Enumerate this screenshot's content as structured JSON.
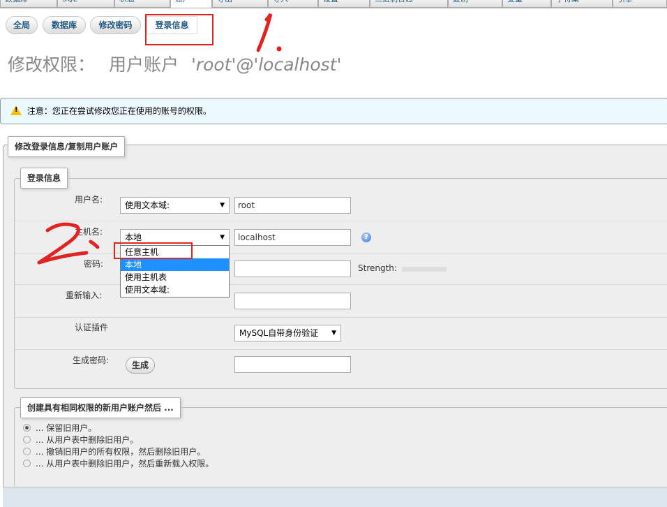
{
  "top_tabs": [
    "数据库",
    "SQL",
    "状态",
    "账户",
    "导出",
    "导入",
    "设置",
    "二进制日志",
    "复制",
    "变量",
    "字符集",
    "引擎"
  ],
  "sub_tabs": [
    {
      "label": "全局"
    },
    {
      "label": "数据库"
    },
    {
      "label": "修改密码"
    },
    {
      "label": "登录信息"
    }
  ],
  "title": {
    "prefix": "修改权限：",
    "account_label": "用户账户",
    "account": "'root'@'localhost'"
  },
  "notice": {
    "text": "注意：您正在尝试修改您正在使用的账号的权限。"
  },
  "outer_legend": "修改登录信息/复制用户账户",
  "login_legend": "登录信息",
  "fields": {
    "username": {
      "label": "用户名:",
      "select_value": "使用文本域:",
      "input_value": "root"
    },
    "hostname": {
      "label": "主机名:",
      "select_value": "本地",
      "input_value": "localhost",
      "options": [
        "任意主机",
        "本地",
        "使用主机表",
        "使用文本域:"
      ],
      "selected_option": "本地"
    },
    "password": {
      "label": "密码:",
      "strength_label": "Strength:"
    },
    "retype": {
      "label": "重新输入:"
    },
    "auth_plugin": {
      "label": "认证插件",
      "select_value": "MySQL自带身份验证"
    },
    "generate": {
      "label": "生成密码:",
      "button": "生成"
    }
  },
  "create_legend": "创建具有相同权限的新用户账户然后 ...",
  "radio_options": [
    {
      "label": "... 保留旧用户。",
      "checked": true
    },
    {
      "label": "... 从用户表中删除旧用户。",
      "checked": false
    },
    {
      "label": "... 撤销旧用户的所有权限，然后删除旧用户。",
      "checked": false
    },
    {
      "label": "... 从用户表中删除旧用户，然后重新载入权限。",
      "checked": false
    }
  ],
  "colors": {
    "annotation_red": "#e32222",
    "selected_option_bg": "#1e90ff",
    "notice_bg": "#ebf8fd"
  },
  "icons": {
    "notice": "warning-icon",
    "hostname_help": "help-icon"
  }
}
